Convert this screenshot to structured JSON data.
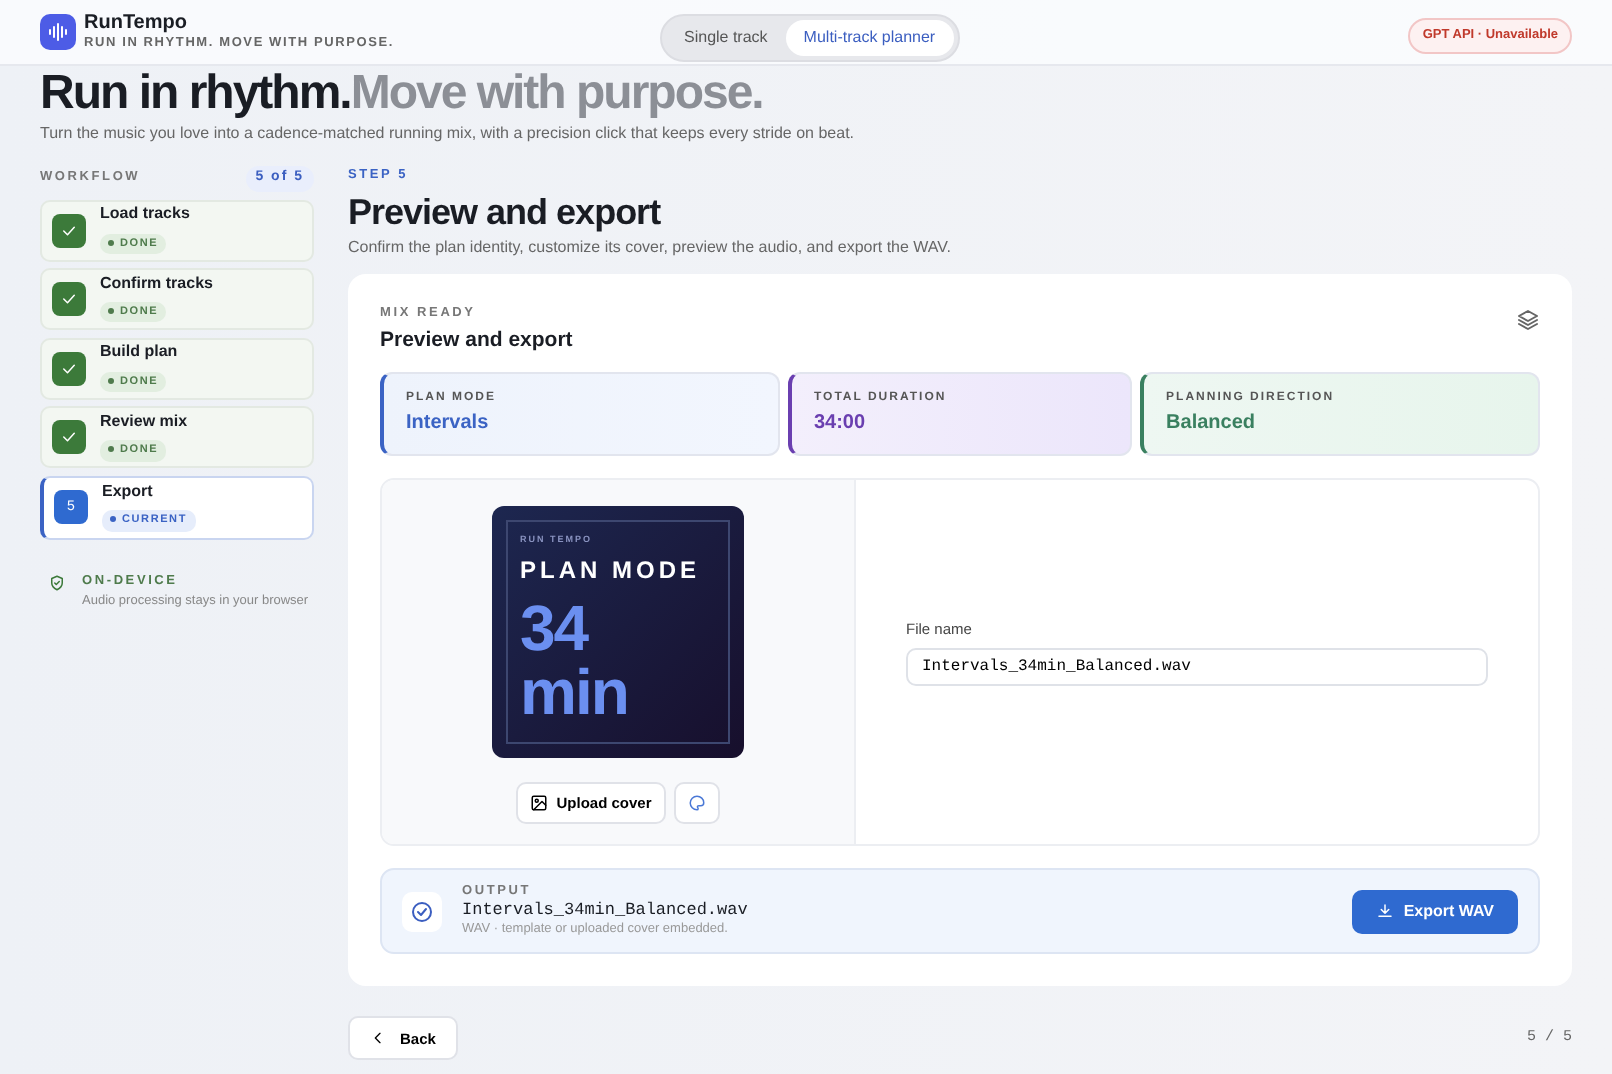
{
  "header": {
    "brand": "RunTempo",
    "tagline": "RUN IN RHYTHM.  MOVE WITH PURPOSE.",
    "mode_tabs": [
      {
        "label": "Single track",
        "selected": false
      },
      {
        "label": "Multi-track planner",
        "selected": true
      }
    ],
    "api_status": "GPT API · Unavailable"
  },
  "hero": {
    "title_strong": "Run in rhythm.",
    "title_soft": "Move with purpose.",
    "subtitle": "Turn the music you love into a cadence-matched running mix, with a precision click that keeps every stride on beat."
  },
  "sidebar": {
    "heading": "WORKFLOW",
    "counter": "5 of 5",
    "steps": [
      {
        "kind": "done",
        "title": "Load tracks",
        "status": "DONE"
      },
      {
        "kind": "done",
        "title": "Confirm tracks",
        "status": "DONE"
      },
      {
        "kind": "done",
        "title": "Build plan",
        "status": "DONE"
      },
      {
        "kind": "done",
        "title": "Review mix",
        "status": "DONE"
      },
      {
        "kind": "current",
        "number": "5",
        "title": "Export",
        "status": "CURRENT"
      }
    ],
    "note": {
      "title": "ON-DEVICE",
      "text": "Audio processing stays in your browser"
    }
  },
  "main": {
    "step_label": "STEP 5",
    "title": "Preview and export",
    "subtitle": "Confirm the plan identity, customize its cover, preview the audio, and export the WAV.",
    "card": {
      "eyebrow": "MIX READY",
      "title": "Preview and export",
      "stats": [
        {
          "label": "PLAN MODE",
          "value": "Intervals",
          "color": "#3b63c4"
        },
        {
          "label": "TOTAL DURATION",
          "value": "34:00",
          "color": "#6a3fb0"
        },
        {
          "label": "PLANNING DIRECTION",
          "value": "Balanced",
          "color": "#3a8060"
        }
      ],
      "cover": {
        "brand": "RUN TEMPO",
        "title": "PLAN MODE",
        "value": "34",
        "unit": "min"
      },
      "upload_button": "Upload cover",
      "file_label": "File name",
      "file_value": "Intervals_34min_Balanced.wav",
      "output": {
        "label": "OUTPUT",
        "filename": "Intervals_34min_Balanced.wav",
        "note": "WAV · template or uploaded cover embedded."
      },
      "export_button": "Export WAV"
    }
  },
  "footer": {
    "back_button": "Back",
    "page": "5 / 5"
  }
}
